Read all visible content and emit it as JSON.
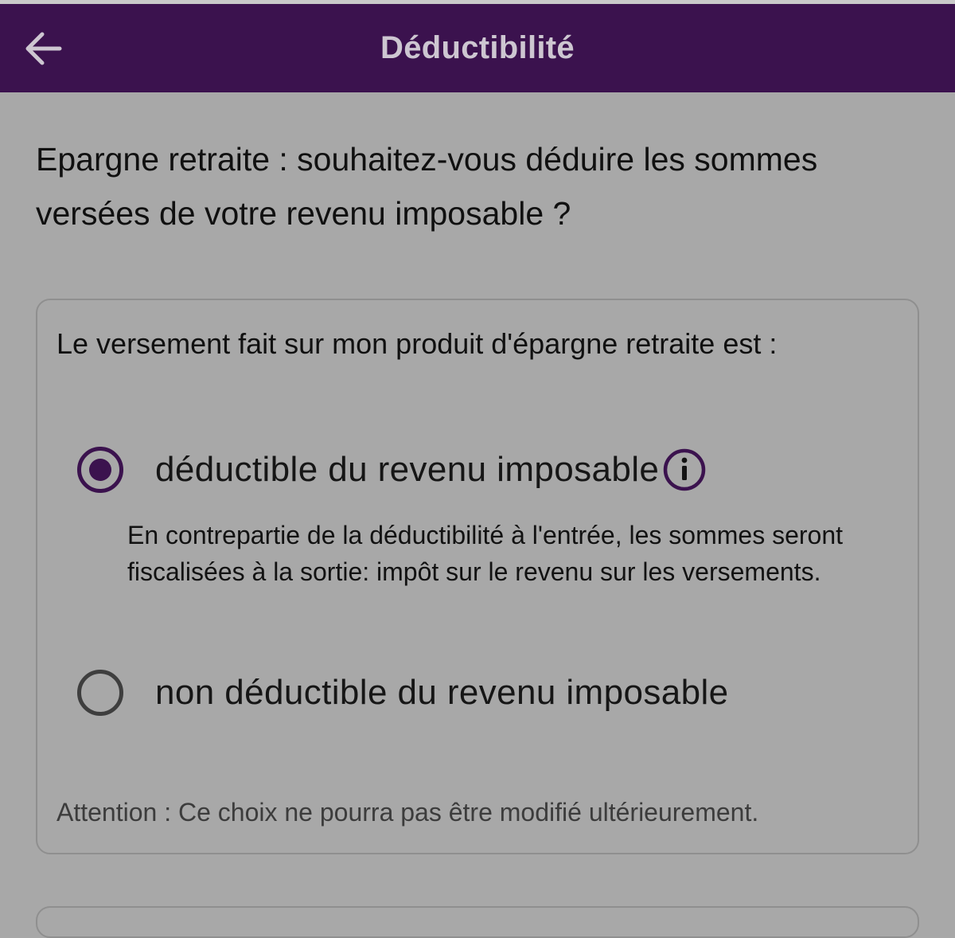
{
  "header": {
    "title": "Déductibilité",
    "back_icon": "arrow-left-icon"
  },
  "question": "Epargne retraite : souhaitez-vous déduire les sommes versées de votre revenu imposable ?",
  "card": {
    "heading": "Le versement fait sur mon produit d'épargne retraite est :",
    "options": [
      {
        "label": "déductible du revenu imposable",
        "selected": true,
        "info_icon": "info-icon",
        "description": "En contrepartie de la déductibilité à l'entrée, les sommes seront fiscalisées à la sortie: impôt sur le revenu sur les versements."
      },
      {
        "label": "non déductible du revenu imposable",
        "selected": false
      }
    ],
    "warning": "Attention : Ce choix ne pourra pas être modifié ultérieurement."
  },
  "colors": {
    "app_bar": "#3b124e",
    "accent": "#3b124e",
    "overlay_background": "#a8a8a8"
  }
}
